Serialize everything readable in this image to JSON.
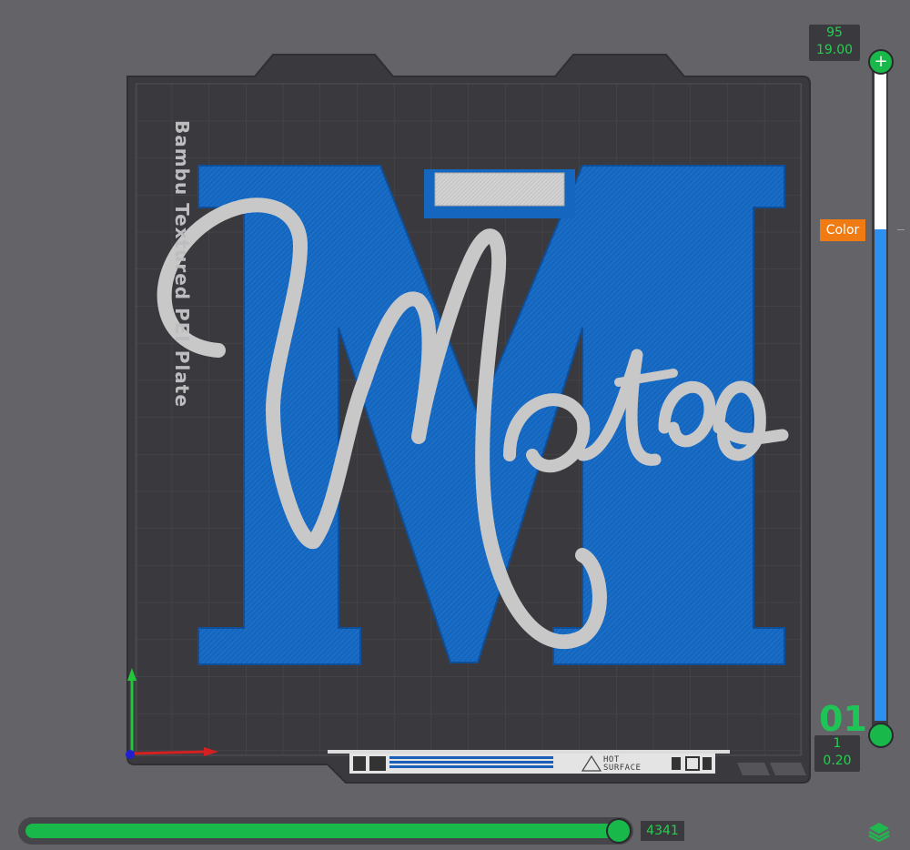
{
  "viewport": {
    "plate_label": "Bambu Textured PEI Plate",
    "model_text": {
      "monogram_letter": "M",
      "script_name": "Mateo"
    },
    "plate_strip": {
      "warning_text_1": "HOT",
      "warning_text_2": "SURFACE"
    }
  },
  "layer_slider": {
    "top_layer": "95",
    "top_height": "19.00",
    "bottom_layer": "1",
    "bottom_height": "0.20",
    "bottom_layer_badge": "01",
    "color_tag": "Color",
    "colors": {
      "upper_segment": "#ffffff",
      "lower_segment": "#2d8ff0",
      "handle": "#18b84a",
      "tag": "#f07b13"
    }
  },
  "move_slider": {
    "value": "4341",
    "progress": 1.0
  },
  "colors": {
    "background": "#646468",
    "plate": "#3a3a3e",
    "model_blue": "#1565c0",
    "model_white": "#c9c9c9",
    "accent_green": "#22d04e"
  },
  "icons": {
    "layers": "layers-icon",
    "plus": "plus-icon",
    "warning": "warning-triangle-icon",
    "axes": "axes-gizmo-icon"
  }
}
